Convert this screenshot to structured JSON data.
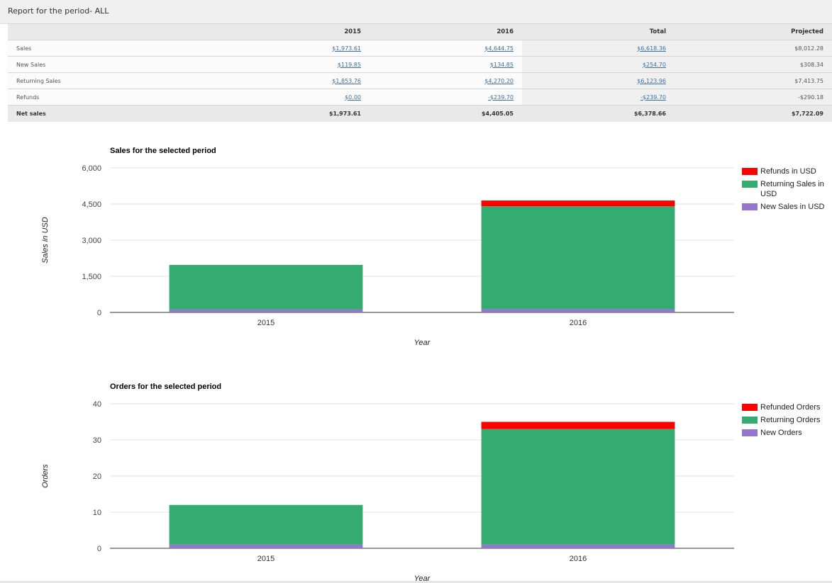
{
  "header": {
    "title": "Report for the period- ALL"
  },
  "table": {
    "columns": [
      "",
      "2015",
      "2016",
      "Total",
      "Projected"
    ],
    "rows": [
      {
        "label": "Sales",
        "values": [
          "$1,973.61",
          "$4,644.75",
          "$6,618.36",
          "$8,012.28"
        ]
      },
      {
        "label": "New Sales",
        "values": [
          "$119.85",
          "$134.85",
          "$254.70",
          "$308.34"
        ]
      },
      {
        "label": "Returning Sales",
        "values": [
          "$1,853.76",
          "$4,270.20",
          "$6,123.96",
          "$7,413.75"
        ]
      },
      {
        "label": "Refunds",
        "values": [
          "$0.00",
          "-$239.70",
          "-$239.70",
          "-$290.18"
        ]
      }
    ],
    "net": {
      "label": "Net sales",
      "values": [
        "$1,973.61",
        "$4,405.05",
        "$6,378.66",
        "$7,722.09"
      ]
    }
  },
  "colors": {
    "refunds": "#ff0000",
    "returning": "#33ab71",
    "new": "#9575cd",
    "link": "#3d6ea5"
  },
  "chart_data": [
    {
      "type": "bar",
      "stacked": true,
      "title": "Sales for the selected period",
      "xlabel": "Year",
      "ylabel": "Sales in USD",
      "categories": [
        "2015",
        "2016"
      ],
      "yticks": [
        "0",
        "1,500",
        "3,000",
        "4,500",
        "6,000"
      ],
      "ylim": [
        0,
        6000
      ],
      "legend_position": "right",
      "series": [
        {
          "name": "New Sales in USD",
          "color": "#9575cd",
          "values": [
            119.85,
            134.85
          ]
        },
        {
          "name": "Returning Sales in USD",
          "color": "#33ab71",
          "values": [
            1853.76,
            4270.2
          ]
        },
        {
          "name": "Refunds in USD",
          "color": "#ff0000",
          "values": [
            0,
            239.7
          ]
        }
      ],
      "legend_order": [
        "Refunds in USD",
        "Returning Sales in USD",
        "New Sales in USD"
      ]
    },
    {
      "type": "bar",
      "stacked": true,
      "title": "Orders for the selected period",
      "xlabel": "Year",
      "ylabel": "Orders",
      "categories": [
        "2015",
        "2016"
      ],
      "yticks": [
        "0",
        "10",
        "20",
        "30",
        "40"
      ],
      "ylim": [
        0,
        40
      ],
      "legend_position": "right",
      "series": [
        {
          "name": "New Orders",
          "color": "#9575cd",
          "values": [
            1,
            1
          ]
        },
        {
          "name": "Returning Orders",
          "color": "#33ab71",
          "values": [
            11,
            32
          ]
        },
        {
          "name": "Refunded Orders",
          "color": "#ff0000",
          "values": [
            0,
            2
          ]
        }
      ],
      "legend_order": [
        "Refunded Orders",
        "Returning Orders",
        "New Orders"
      ]
    }
  ]
}
